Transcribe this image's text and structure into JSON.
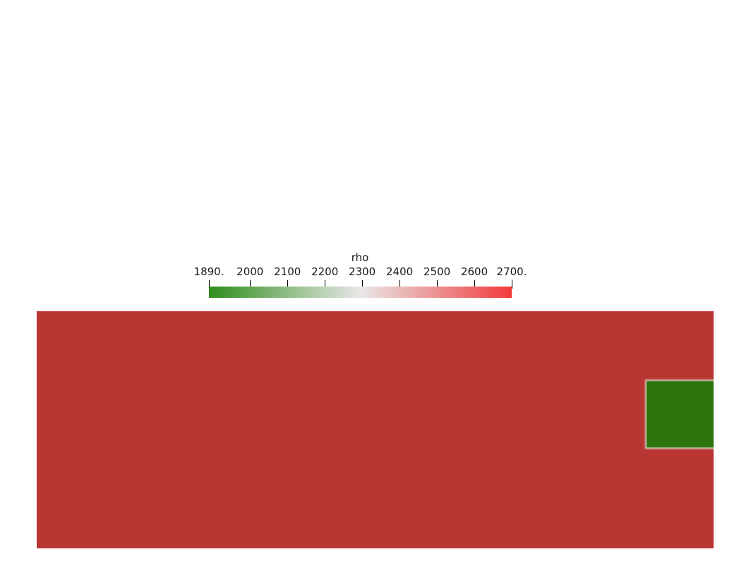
{
  "colorbar": {
    "title": "rho",
    "min": 1890,
    "max": 2700,
    "ticks": [
      {
        "value": 1890,
        "label": "1890."
      },
      {
        "value": 2000,
        "label": "2000"
      },
      {
        "value": 2100,
        "label": "2100"
      },
      {
        "value": 2200,
        "label": "2200"
      },
      {
        "value": 2300,
        "label": "2300"
      },
      {
        "value": 2400,
        "label": "2400"
      },
      {
        "value": 2500,
        "label": "2500"
      },
      {
        "value": 2600,
        "label": "2600"
      },
      {
        "value": 2700,
        "label": "2700."
      }
    ],
    "gradient_colors": [
      "#2f8e1b",
      "#e8e8e8",
      "#f23b3b"
    ]
  },
  "field": {
    "background_color": "#b93633",
    "inclusion_color": "#2e7510"
  }
}
